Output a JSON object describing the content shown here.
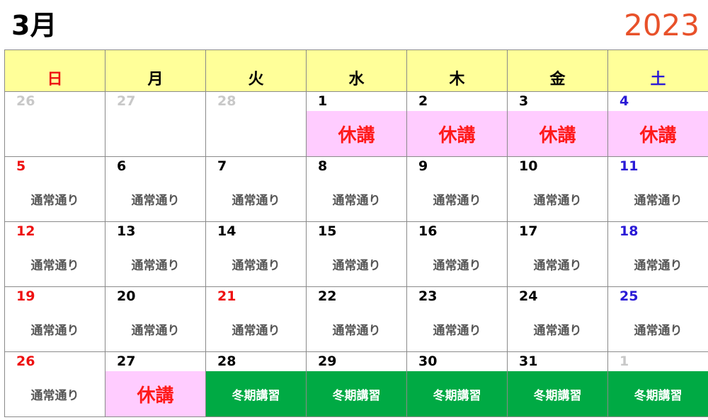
{
  "header": {
    "month": "3月",
    "year": "2023"
  },
  "colors": {
    "header_bg": "#ffff99",
    "sunday": "#ee1111",
    "saturday": "#2a1ad6",
    "other_month": "#c8c8c8",
    "kyuko_bg": "#ffccff",
    "kyuko_text": "#ff1a1a",
    "koshu_bg": "#00aa44",
    "year": "#e8512a"
  },
  "weekdays": [
    {
      "label": "日",
      "tone": "sun"
    },
    {
      "label": "月",
      "tone": "weekday"
    },
    {
      "label": "火",
      "tone": "weekday"
    },
    {
      "label": "水",
      "tone": "weekday"
    },
    {
      "label": "木",
      "tone": "weekday"
    },
    {
      "label": "金",
      "tone": "weekday"
    },
    {
      "label": "土",
      "tone": "sat"
    }
  ],
  "weeks": [
    [
      {
        "day": "26",
        "tone": "grey",
        "status": "empty",
        "label": ""
      },
      {
        "day": "27",
        "tone": "grey",
        "status": "empty",
        "label": ""
      },
      {
        "day": "28",
        "tone": "grey",
        "status": "empty",
        "label": ""
      },
      {
        "day": "1",
        "tone": "weekday",
        "status": "kyuko",
        "label": "休講"
      },
      {
        "day": "2",
        "tone": "weekday",
        "status": "kyuko",
        "label": "休講"
      },
      {
        "day": "3",
        "tone": "weekday",
        "status": "kyuko",
        "label": "休講"
      },
      {
        "day": "4",
        "tone": "sat",
        "status": "kyuko",
        "label": "休講"
      }
    ],
    [
      {
        "day": "5",
        "tone": "sun",
        "status": "normal",
        "label": "通常通り"
      },
      {
        "day": "6",
        "tone": "weekday",
        "status": "normal",
        "label": "通常通り"
      },
      {
        "day": "7",
        "tone": "weekday",
        "status": "normal",
        "label": "通常通り"
      },
      {
        "day": "8",
        "tone": "weekday",
        "status": "normal",
        "label": "通常通り"
      },
      {
        "day": "9",
        "tone": "weekday",
        "status": "normal",
        "label": "通常通り"
      },
      {
        "day": "10",
        "tone": "weekday",
        "status": "normal",
        "label": "通常通り"
      },
      {
        "day": "11",
        "tone": "sat",
        "status": "normal",
        "label": "通常通り"
      }
    ],
    [
      {
        "day": "12",
        "tone": "sun",
        "status": "normal",
        "label": "通常通り"
      },
      {
        "day": "13",
        "tone": "weekday",
        "status": "normal",
        "label": "通常通り"
      },
      {
        "day": "14",
        "tone": "weekday",
        "status": "normal",
        "label": "通常通り"
      },
      {
        "day": "15",
        "tone": "weekday",
        "status": "normal",
        "label": "通常通り"
      },
      {
        "day": "16",
        "tone": "weekday",
        "status": "normal",
        "label": "通常通り"
      },
      {
        "day": "17",
        "tone": "weekday",
        "status": "normal",
        "label": "通常通り"
      },
      {
        "day": "18",
        "tone": "sat",
        "status": "normal",
        "label": "通常通り"
      }
    ],
    [
      {
        "day": "19",
        "tone": "sun",
        "status": "normal",
        "label": "通常通り"
      },
      {
        "day": "20",
        "tone": "weekday",
        "status": "normal",
        "label": "通常通り"
      },
      {
        "day": "21",
        "tone": "sun",
        "status": "normal",
        "label": "通常通り"
      },
      {
        "day": "22",
        "tone": "weekday",
        "status": "normal",
        "label": "通常通り"
      },
      {
        "day": "23",
        "tone": "weekday",
        "status": "normal",
        "label": "通常通り"
      },
      {
        "day": "24",
        "tone": "weekday",
        "status": "normal",
        "label": "通常通り"
      },
      {
        "day": "25",
        "tone": "sat",
        "status": "normal",
        "label": "通常通り"
      }
    ],
    [
      {
        "day": "26",
        "tone": "sun",
        "status": "normal",
        "label": "通常通り"
      },
      {
        "day": "27",
        "tone": "weekday",
        "status": "kyuko",
        "label": "休講"
      },
      {
        "day": "28",
        "tone": "weekday",
        "status": "koshu",
        "label": "冬期講習"
      },
      {
        "day": "29",
        "tone": "weekday",
        "status": "koshu",
        "label": "冬期講習"
      },
      {
        "day": "30",
        "tone": "weekday",
        "status": "koshu",
        "label": "冬期講習"
      },
      {
        "day": "31",
        "tone": "weekday",
        "status": "koshu",
        "label": "冬期講習"
      },
      {
        "day": "1",
        "tone": "grey",
        "status": "koshu",
        "label": "冬期講習"
      }
    ]
  ]
}
